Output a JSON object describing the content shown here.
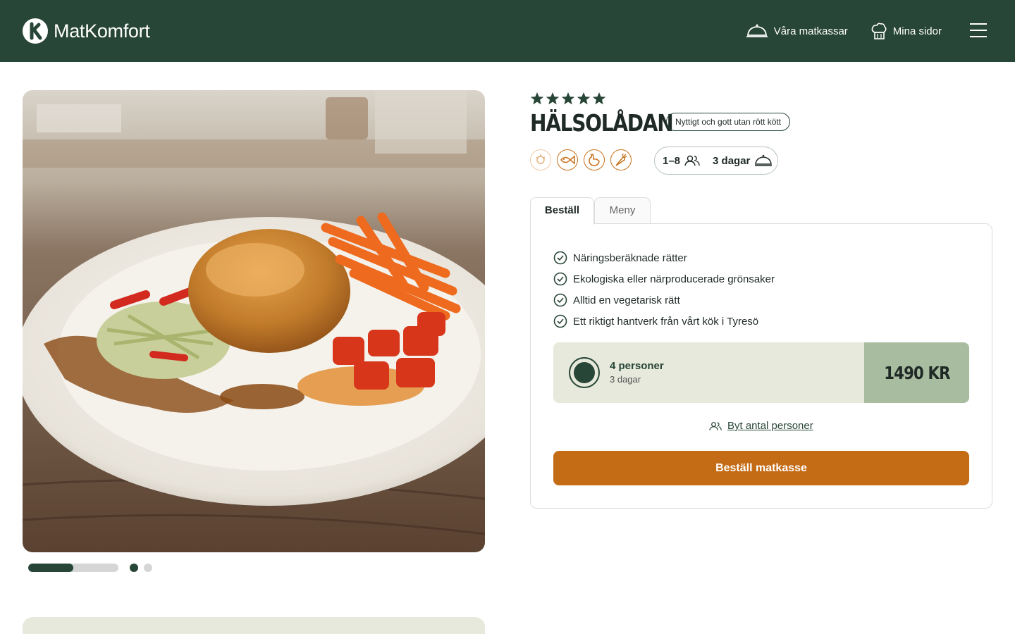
{
  "header": {
    "brand": "MatKomfort",
    "nav": [
      {
        "label": "Våra matkassar",
        "icon": "cloche-icon"
      },
      {
        "label": "Mina sidor",
        "icon": "chef-hat-icon"
      }
    ],
    "menu_icon": "hamburger-menu-icon",
    "bg_color": "#284637"
  },
  "gallery": {
    "image_alt": "Plated roasted chicken with carrots, cabbage salad and tomatoes",
    "progress": 0.5,
    "slides": 2,
    "active_slide": 1
  },
  "product": {
    "rating": 5,
    "title": "HÄLSOLÅDAN",
    "tag": "Nyttigt och gott utan rött kött",
    "diet_icons": [
      "vegetarian-icon",
      "fish-icon",
      "chicken-icon",
      "carrot-icon"
    ],
    "persons": "1–8",
    "days": "3 dagar"
  },
  "tabs": [
    {
      "label": "Beställ",
      "active": true
    },
    {
      "label": "Meny",
      "active": false
    }
  ],
  "features": [
    "Näringsberäknade rätter",
    "Ekologiska eller närproducerade grönsaker",
    "Alltid en vegetarisk rätt",
    "Ett riktigt hantverk från vårt kök i Tyresö"
  ],
  "option": {
    "title": "4 personer",
    "subtitle": "3 dagar",
    "price": "1490 KR",
    "selected": true
  },
  "change_persons_label": "Byt antal personer",
  "order_button": "Beställ matkasse",
  "colors": {
    "primary": "#284637",
    "accent": "#c46b15",
    "option_bg": "#e6e9dc",
    "price_bg": "#a8bca0"
  }
}
